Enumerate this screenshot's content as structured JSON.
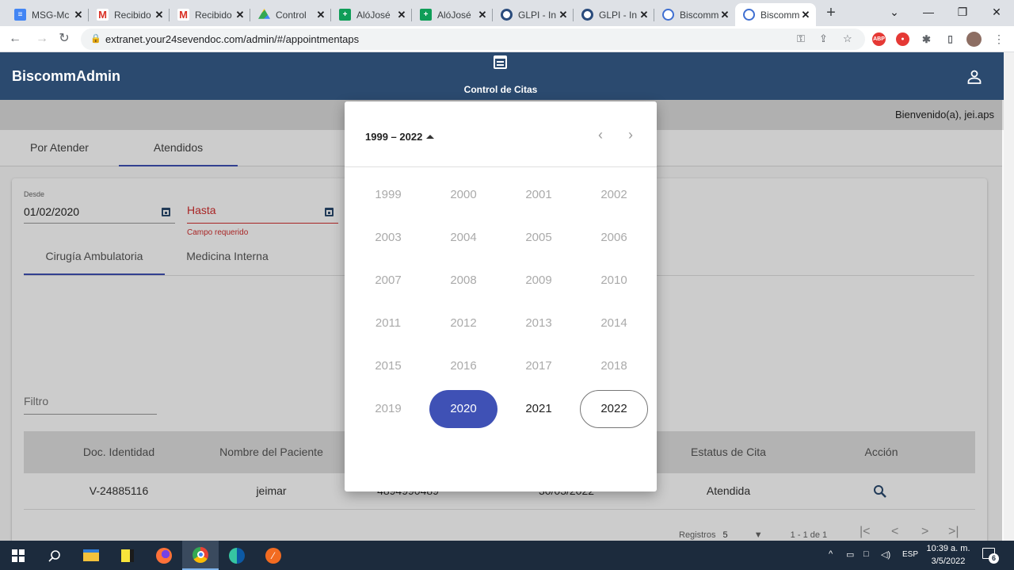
{
  "browser": {
    "tabs": [
      {
        "title": "MSG-Mc",
        "fav": "docs"
      },
      {
        "title": "Recibido",
        "fav": "gmail"
      },
      {
        "title": "Recibido",
        "fav": "gmail"
      },
      {
        "title": "Control",
        "fav": "drive"
      },
      {
        "title": "AlóJosé",
        "fav": "sheets"
      },
      {
        "title": "AlóJosé",
        "fav": "sheets"
      },
      {
        "title": "GLPI - In",
        "fav": "glpi"
      },
      {
        "title": "GLPI - In",
        "fav": "glpi"
      },
      {
        "title": "Biscomm",
        "fav": "bis"
      },
      {
        "title": "Biscomm",
        "fav": "bis"
      }
    ],
    "new_tab": "+",
    "url": "extranet.your24sevendoc.com/admin/#/appointmentaps",
    "extensions": [
      "ABP",
      "ext",
      "puzzle",
      "sidebar",
      "profile"
    ]
  },
  "app": {
    "brand": "BiscommAdmin",
    "page_title": "Control de Citas",
    "welcome": "Bienvenido(a), jei.aps",
    "tabs": [
      "Por Atender",
      "Atendidos"
    ],
    "desde_label": "Desde",
    "desde_value": "01/02/2020",
    "hasta_placeholder": "Hasta",
    "hasta_error": "Campo requerido",
    "subtabs": [
      "Cirugía Ambulatoria",
      "Medicina Interna"
    ],
    "filter_placeholder": "Filtro",
    "columns": [
      "Doc. Identidad",
      "Nombre del Paciente",
      "",
      "",
      "Estatus de Cita",
      "Acción"
    ],
    "row": {
      "doc": "V-24885116",
      "name": "jeimar",
      "phone": "4894990489",
      "date": "30/03/2022",
      "status": "Atendida"
    },
    "paginator": {
      "label": "Registros",
      "size": "5",
      "range": "1 - 1 de 1"
    }
  },
  "picker": {
    "period": "1999 – 2022",
    "years": [
      "1999",
      "2000",
      "2001",
      "2002",
      "2003",
      "2004",
      "2005",
      "2006",
      "2007",
      "2008",
      "2009",
      "2010",
      "2011",
      "2012",
      "2013",
      "2014",
      "2015",
      "2016",
      "2017",
      "2018",
      "2019",
      "2020",
      "2021",
      "2022"
    ],
    "selected": "2020",
    "today": "2022",
    "enabled": [
      "2020",
      "2021",
      "2022"
    ]
  },
  "taskbar": {
    "lang": "ESP",
    "time": "10:39 a. m.",
    "date": "3/5/2022",
    "notifications": "6"
  }
}
